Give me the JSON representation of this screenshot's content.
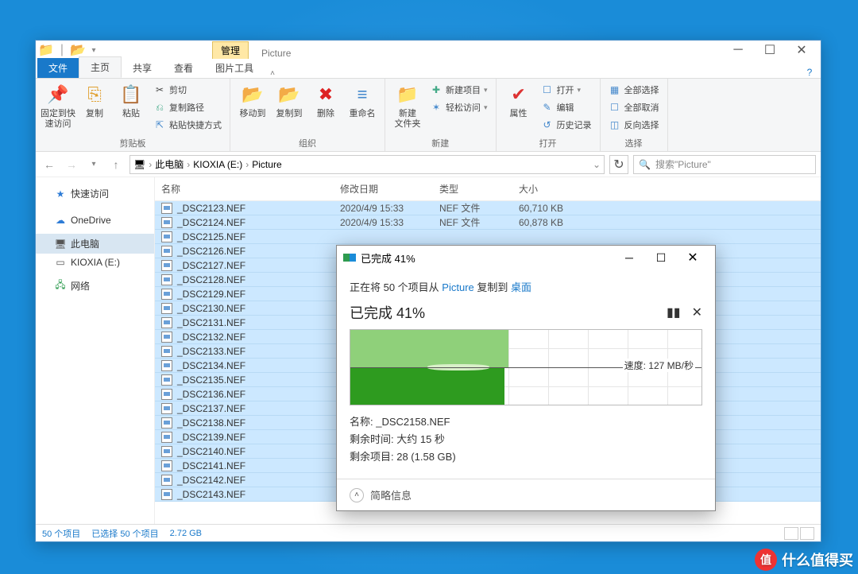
{
  "explorer": {
    "ctx_tab": "管理",
    "ctx_label": "Picture",
    "tabs": {
      "file": "文件",
      "home": "主页",
      "share": "共享",
      "view": "查看",
      "pict": "图片工具"
    },
    "ribbon": {
      "clipboard": {
        "pin": "固定到快\n速访问",
        "copy": "复制",
        "paste": "粘贴",
        "cut": "剪切",
        "copypath": "复制路径",
        "shortcut": "粘贴快捷方式",
        "label": "剪贴板"
      },
      "organize": {
        "moveto": "移动到",
        "copyto": "复制到",
        "delete": "删除",
        "rename": "重命名",
        "label": "组织"
      },
      "new": {
        "newfolder": "新建\n文件夹",
        "newitem": "新建项目",
        "easyaccess": "轻松访问",
        "label": "新建"
      },
      "open": {
        "properties": "属性",
        "open": "打开",
        "edit": "编辑",
        "history": "历史记录",
        "label": "打开"
      },
      "select": {
        "all": "全部选择",
        "none": "全部取消",
        "invert": "反向选择",
        "label": "选择"
      }
    },
    "breadcrumb": {
      "root": "此电脑",
      "drive": "KIOXIA (E:)",
      "folder": "Picture"
    },
    "search_placeholder": "搜索\"Picture\"",
    "nav": {
      "quick": "快速访问",
      "onedrive": "OneDrive",
      "thispc": "此电脑",
      "drive": "KIOXIA (E:)",
      "network": "网络"
    },
    "columns": {
      "name": "名称",
      "date": "修改日期",
      "type": "类型",
      "size": "大小"
    },
    "files": [
      {
        "name": "_DSC2123.NEF",
        "date": "2020/4/9 15:33",
        "type": "NEF 文件",
        "size": "60,710 KB"
      },
      {
        "name": "_DSC2124.NEF",
        "date": "2020/4/9 15:33",
        "type": "NEF 文件",
        "size": "60,878 KB"
      },
      {
        "name": "_DSC2125.NEF",
        "date": "",
        "type": "",
        "size": ""
      },
      {
        "name": "_DSC2126.NEF",
        "date": "",
        "type": "",
        "size": ""
      },
      {
        "name": "_DSC2127.NEF",
        "date": "",
        "type": "",
        "size": ""
      },
      {
        "name": "_DSC2128.NEF",
        "date": "",
        "type": "",
        "size": ""
      },
      {
        "name": "_DSC2129.NEF",
        "date": "",
        "type": "",
        "size": ""
      },
      {
        "name": "_DSC2130.NEF",
        "date": "",
        "type": "",
        "size": ""
      },
      {
        "name": "_DSC2131.NEF",
        "date": "",
        "type": "",
        "size": ""
      },
      {
        "name": "_DSC2132.NEF",
        "date": "",
        "type": "",
        "size": ""
      },
      {
        "name": "_DSC2133.NEF",
        "date": "",
        "type": "",
        "size": ""
      },
      {
        "name": "_DSC2134.NEF",
        "date": "",
        "type": "",
        "size": ""
      },
      {
        "name": "_DSC2135.NEF",
        "date": "",
        "type": "",
        "size": ""
      },
      {
        "name": "_DSC2136.NEF",
        "date": "",
        "type": "",
        "size": ""
      },
      {
        "name": "_DSC2137.NEF",
        "date": "",
        "type": "",
        "size": ""
      },
      {
        "name": "_DSC2138.NEF",
        "date": "",
        "type": "",
        "size": ""
      },
      {
        "name": "_DSC2139.NEF",
        "date": "",
        "type": "",
        "size": ""
      },
      {
        "name": "_DSC2140.NEF",
        "date": "",
        "type": "",
        "size": ""
      },
      {
        "name": "_DSC2141.NEF",
        "date": "",
        "type": "",
        "size": ""
      },
      {
        "name": "_DSC2142.NEF",
        "date": "",
        "type": "",
        "size": ""
      },
      {
        "name": "_DSC2143.NEF",
        "date": "",
        "type": "",
        "size": ""
      }
    ],
    "status": {
      "count": "50 个项目",
      "selected": "已选择 50 个项目",
      "size": "2.72 GB"
    }
  },
  "copy": {
    "title": "已完成 41%",
    "src_1": "正在将 50 个项目从 ",
    "src_link1": "Picture",
    "src_2": " 复制到 ",
    "src_link2": "桌面",
    "pct": "已完成 41%",
    "progress_percent": 41,
    "rate": "速度: 127 MB/秒",
    "name_label": "名称: ",
    "name_value": "_DSC2158.NEF",
    "time_label": "剩余时间: ",
    "time_value": "大约 15 秒",
    "items_label": "剩余项目: ",
    "items_value": "28 (1.58 GB)",
    "less": "简略信息"
  },
  "watermark": {
    "badge": "值",
    "text": "什么值得买"
  }
}
